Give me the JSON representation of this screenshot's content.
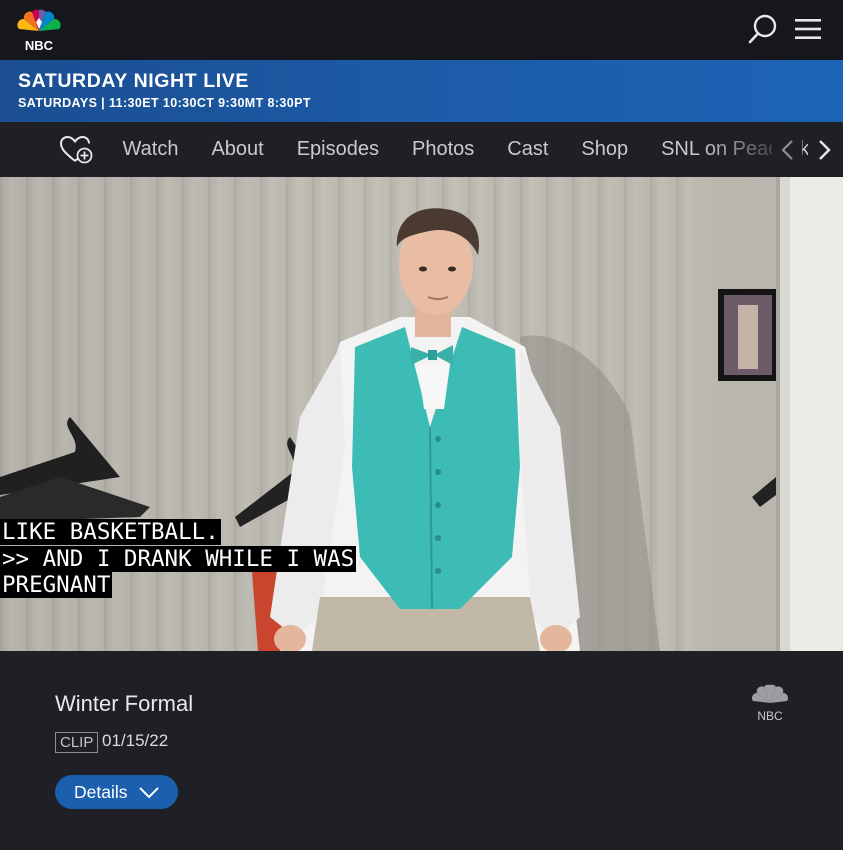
{
  "header": {
    "logo_text": "NBC",
    "icons": {
      "search": "search-icon",
      "menu": "hamburger-menu-icon"
    }
  },
  "show": {
    "title": "SATURDAY NIGHT LIVE",
    "schedule": "SATURDAYS | 11:30ET 10:30CT 9:30MT 8:30PT"
  },
  "nav": {
    "items": [
      "Watch",
      "About",
      "Episodes",
      "Photos",
      "Cast",
      "Shop",
      "SNL on Peacock"
    ],
    "icons": {
      "favorite": "heart-plus-icon",
      "prev": "chevron-left-icon",
      "next": "chevron-right-icon"
    }
  },
  "video": {
    "captions": [
      "LIKE BASKETBALL.",
      ">> AND I DRANK WHILE I WAS",
      "PREGNANT"
    ]
  },
  "clip": {
    "title": "Winter Formal",
    "badge": "CLIP",
    "date": "01/15/22",
    "details_label": "Details",
    "network_logo_text": "NBC"
  },
  "colors": {
    "topbar": "#16171c",
    "banner": "#1c5aa5",
    "page_bg": "#1f2025",
    "button": "#1b5fae",
    "peacock": [
      "#fcb711",
      "#f37021",
      "#cc004c",
      "#6460aa",
      "#0089d0",
      "#0db14b"
    ]
  }
}
